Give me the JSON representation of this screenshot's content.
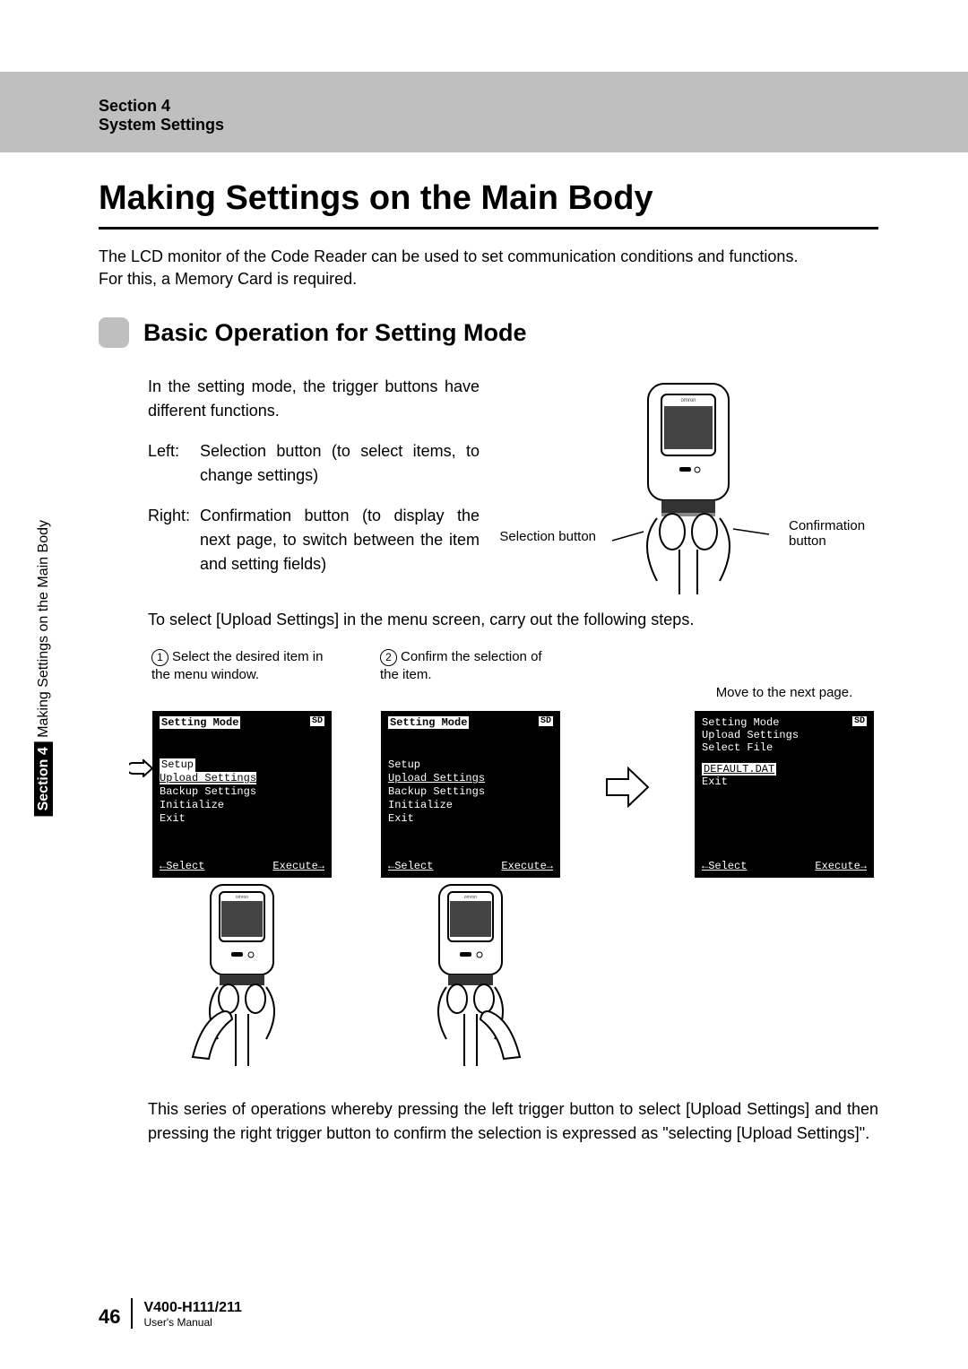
{
  "header": {
    "section_label": "Section 4",
    "section_title": "System Settings"
  },
  "title": "Making Settings on the Main Body",
  "intro_line1": "The LCD monitor of the Code Reader can be used to set communication conditions and functions.",
  "intro_line2": "For this, a Memory Card is required.",
  "subheading": "Basic Operation for Setting Mode",
  "body": {
    "lead": "In the setting mode, the trigger buttons have different functions.",
    "left_label": "Left:",
    "left_desc": "Selection button (to select items, to change settings)",
    "right_label": "Right:",
    "right_desc": "Confirmation button (to display the next page, to switch between the item and setting fields)"
  },
  "device_labels": {
    "selection": "Selection button",
    "confirmation_l1": "Confirmation",
    "confirmation_l2": "button"
  },
  "select_para": "To select [Upload Settings] in the menu screen, carry out the following steps.",
  "steps": {
    "s1_num": "1",
    "s1_caption": "Select the desired item in the menu window.",
    "s2_num": "2",
    "s2_caption": "Confirm the selection of the item.",
    "s3_caption": "Move to the next page."
  },
  "lcd_common": {
    "title": "Setting Mode",
    "sd": "SD",
    "select": "←Select",
    "execute": "Execute→"
  },
  "lcd1": {
    "line1": "Setup",
    "line2": "Upload Settings",
    "line3": "Backup Settings",
    "line4": "Initialize",
    "line5": "Exit"
  },
  "lcd2": {
    "line1": "Setup",
    "line2": "Upload Settings",
    "line3": "Backup Settings",
    "line4": "Initialize",
    "line5": "Exit"
  },
  "lcd3": {
    "breadcrumb1": "Setting Mode",
    "breadcrumb2": "Upload Settings",
    "breadcrumb3": "Select File",
    "option": "DEFAULT.DAT",
    "exit": "Exit"
  },
  "closing_para": "This series of operations whereby pressing the left trigger button to select [Upload Settings] and then pressing the right trigger button to confirm the selection is expressed as \"selecting [Upload Settings]\".",
  "side_tab": {
    "bold": "Section 4",
    "rest": " Making Settings on the Main Body"
  },
  "footer": {
    "page": "46",
    "model": "V400-H111/211",
    "manual": "User's Manual"
  }
}
